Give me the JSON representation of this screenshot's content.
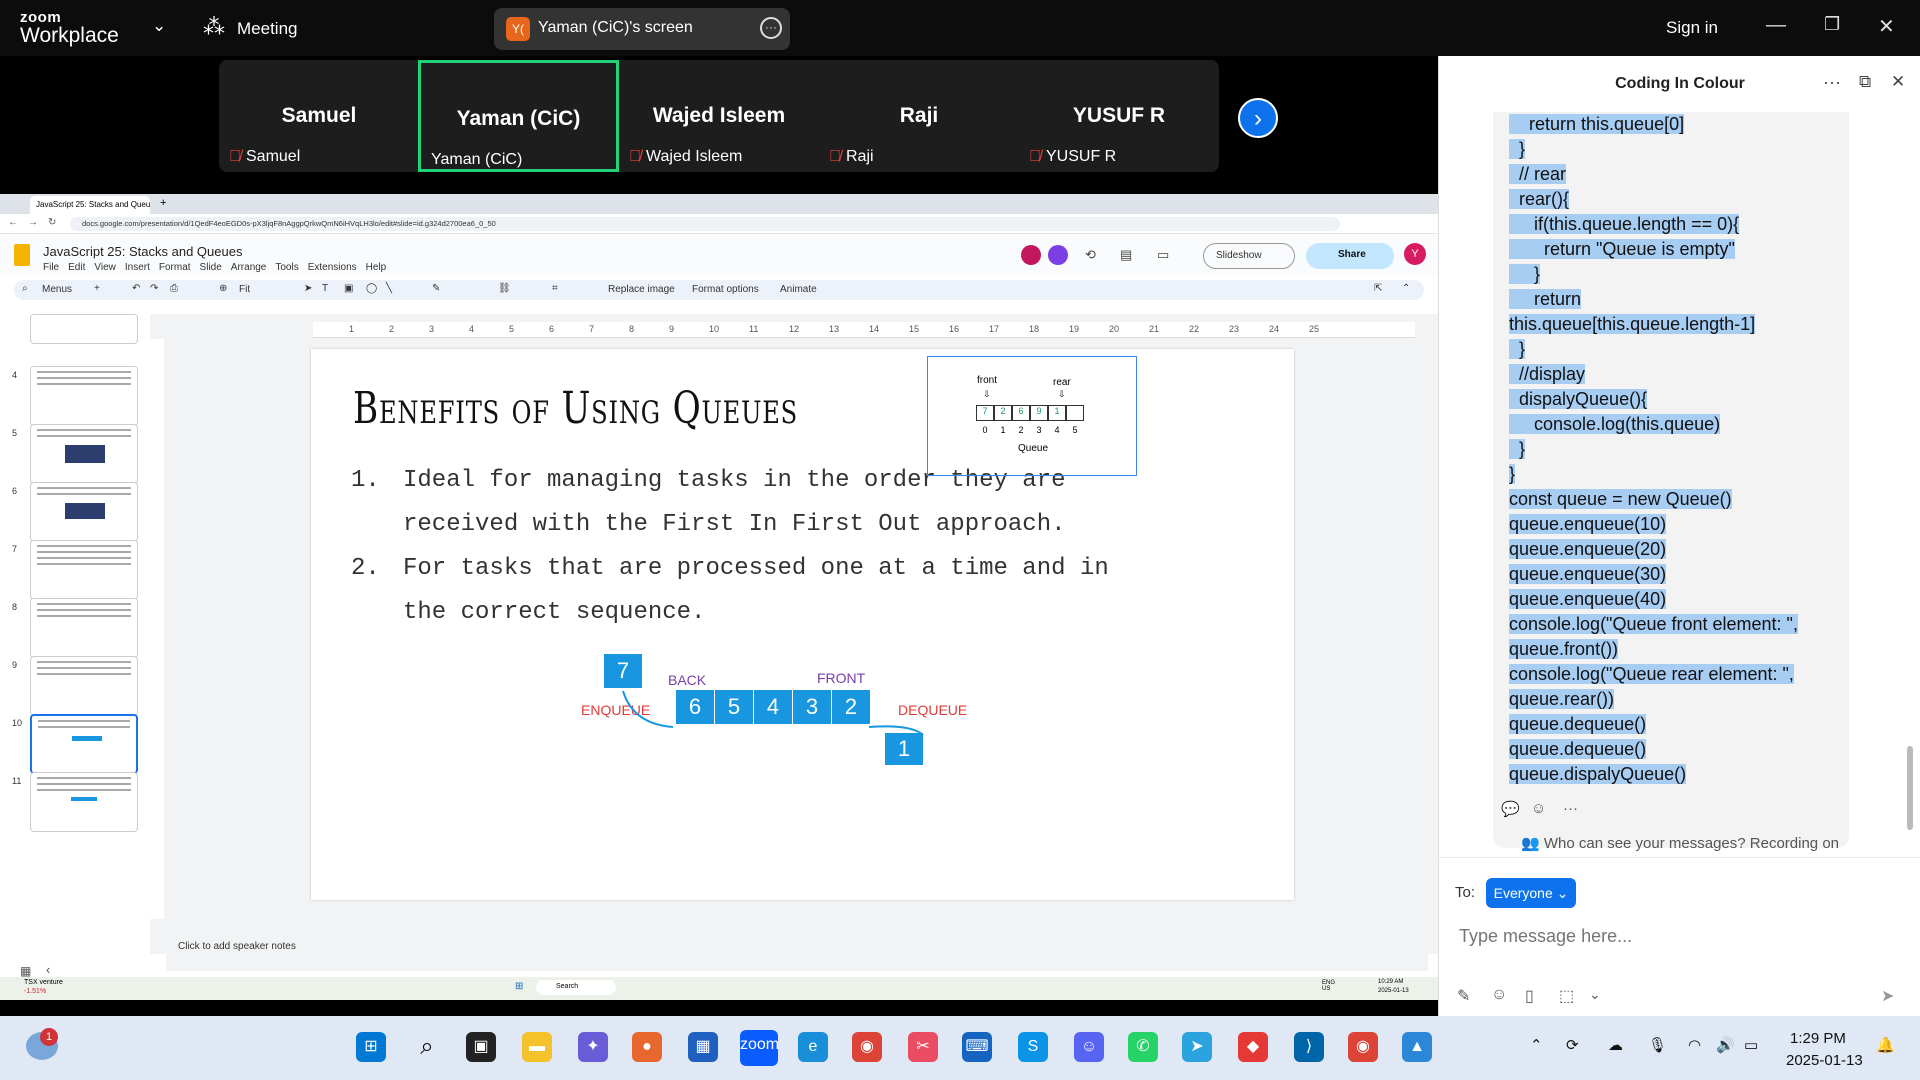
{
  "app": {
    "logo_line1": "zoom",
    "logo_line2": "Workplace",
    "meeting_label": "Meeting",
    "screen_label": "Yaman (CiC)'s screen",
    "screen_avatar": "Y(",
    "sign_in": "Sign in"
  },
  "participants": [
    {
      "display": "Samuel",
      "name": "Samuel",
      "muted": true,
      "active": false
    },
    {
      "display": "Yaman (CiC)",
      "name": "Yaman (CiC)",
      "muted": false,
      "active": true
    },
    {
      "display": "Wajed Isleem",
      "name": "Wajed Isleem",
      "muted": true,
      "active": false
    },
    {
      "display": "Raji",
      "name": "Raji",
      "muted": true,
      "active": false
    },
    {
      "display": "YUSUF R",
      "name": "YUSUF R",
      "muted": true,
      "active": false
    }
  ],
  "browser": {
    "tab_title": "JavaScript 25: Stacks and Queu...",
    "url": "docs.google.com/presentation/d/1QedF4eoEGD0s-pX3ljqF8nAggpQrkwQmN6iHVqLH3lo/edit#slide=id.g324d2700ea6_0_50"
  },
  "slides_app": {
    "doc_title": "JavaScript 25: Stacks and Queues",
    "menu": [
      "File",
      "Edit",
      "View",
      "Insert",
      "Format",
      "Slide",
      "Arrange",
      "Tools",
      "Extensions",
      "Help"
    ],
    "toolbar": {
      "menus": "Menus",
      "zoom": "Fit",
      "replace_image": "Replace image",
      "format_options": "Format options",
      "animate": "Animate"
    },
    "slideshow": "Slideshow",
    "share": "Share",
    "user_initial": "Y",
    "ruler": [
      "1",
      "2",
      "3",
      "4",
      "5",
      "6",
      "7",
      "8",
      "9",
      "10",
      "11",
      "12",
      "13",
      "14",
      "15",
      "16",
      "17",
      "18",
      "19",
      "20",
      "21",
      "22",
      "23",
      "24",
      "25"
    ],
    "thumbnails": [
      "4",
      "5",
      "6",
      "7",
      "8",
      "9",
      "10",
      "11"
    ],
    "speaker_notes": "Click to add speaker notes"
  },
  "slide": {
    "title": "Benefits of Using Queues",
    "items": [
      {
        "num": "1.",
        "text": "Ideal for managing tasks in the order they are received with the First In First Out approach."
      },
      {
        "num": "2.",
        "text": "For tasks that are processed one at a time and in the correct sequence."
      }
    ],
    "diagram_small": {
      "front": "front",
      "rear": "rear",
      "cells": [
        "7",
        "2",
        "6",
        "9",
        "1",
        ""
      ],
      "indices": [
        "0",
        "1",
        "2",
        "3",
        "4",
        "5"
      ],
      "caption": "Queue"
    },
    "diagram_big": {
      "incoming": "7",
      "queue": [
        "6",
        "5",
        "4",
        "3",
        "2"
      ],
      "outgoing": "1",
      "back": "BACK",
      "front": "FRONT",
      "enqueue": "ENQUEUE",
      "dequeue": "DEQUEUE"
    }
  },
  "inner_taskbar": {
    "stock": "TSX venture",
    "stock_change": "-1.51%",
    "search": "Search",
    "lang": "ENG US",
    "time": "10:29 AM",
    "date": "2025-01-13"
  },
  "chat": {
    "title": "Coding In Colour",
    "code": [
      "    return this.queue[0]",
      "  }",
      "  // rear",
      "  rear(){",
      "     if(this.queue.length == 0){",
      "       return \"Queue is empty\"",
      "     }",
      "     return",
      "this.queue[this.queue.length-1]",
      "  }",
      "  //display",
      "  dispalyQueue(){",
      "     console.log(this.queue)",
      "  }",
      "}",
      "const queue = new Queue()",
      "queue.enqueue(10)",
      "queue.enqueue(20)",
      "queue.enqueue(30)",
      "queue.enqueue(40)",
      "console.log(\"Queue front element: \",",
      "queue.front())",
      "console.log(\"Queue rear element: \",",
      "queue.rear())",
      "queue.dequeue()",
      "queue.dequeue()",
      "queue.dispalyQueue()"
    ],
    "visibility": "Who can see your messages? Recording on",
    "to_label": "To:",
    "recipient": "Everyone",
    "placeholder": "Type message here..."
  },
  "taskbar": {
    "time": "1:29 PM",
    "date": "2025-01-13",
    "weather_badge": "1"
  },
  "colors": {
    "zoom_blue": "#0e72ed",
    "active_green": "#22d27a",
    "queue_blue": "#1897e0",
    "highlight": "#a7cdf3"
  }
}
